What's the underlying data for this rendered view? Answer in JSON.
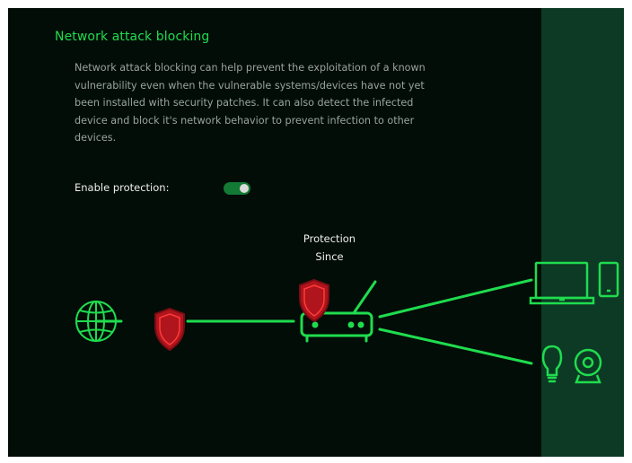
{
  "section": {
    "title": "Network attack blocking",
    "description": "Network attack blocking can help prevent the exploitation of a known vulnerability even when the vulnerable systems/devices have not yet been installed with security patches. It can also detect the infected device and block it's network behavior to prevent infection to other devices."
  },
  "setting": {
    "label": "Enable protection:",
    "enabled": true
  },
  "diagram": {
    "protection_line1": "Protection",
    "protection_line2": "Since"
  },
  "colors": {
    "accent_green": "#1fdc4e",
    "shield_red": "#c0171f",
    "background": "#030d07",
    "strip": "#0d3a25"
  },
  "icons": [
    "globe-icon",
    "shield-icon",
    "router-icon",
    "laptop-icon",
    "phone-icon",
    "bulb-icon",
    "webcam-icon"
  ]
}
